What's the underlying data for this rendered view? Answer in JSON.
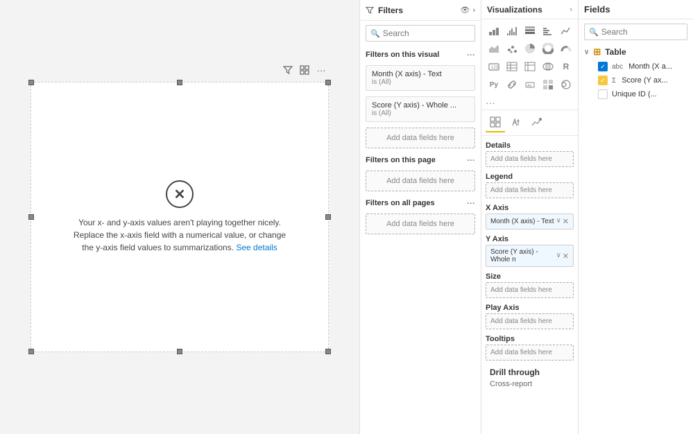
{
  "canvas": {
    "error_message": "Your x- and y-axis values aren't playing together nicely. Replace the x-axis field with a numerical value, or change the y-axis field values to summarizations.",
    "see_details": "See details",
    "toolbar": {
      "filter_icon": "▽",
      "focus_icon": "⊡",
      "more_icon": "···"
    }
  },
  "filters_panel": {
    "title": "Filters",
    "search_placeholder": "Search",
    "section_on_visual": "Filters on this visual",
    "section_on_page": "Filters on this page",
    "section_all_pages": "Filters on all pages",
    "filter1_title": "Month (X axis) - Text",
    "filter1_value": "is (All)",
    "filter2_title": "Score (Y axis) - Whole ...",
    "filter2_value": "is (All)",
    "add_data_label": "Add data fields here",
    "more_icon": "···"
  },
  "viz_panel": {
    "title": "Visualizations",
    "icons": [
      "📊",
      "📈",
      "📉",
      "📋",
      "🔲",
      "📍",
      "🗺",
      "⏱",
      "🥧",
      "📡",
      "🎯",
      "🔷",
      "🔵",
      "📐",
      "Ⓡ",
      "🐍",
      "🔗",
      "💬",
      "📺",
      "🖼"
    ],
    "tabs": [
      {
        "id": "fields",
        "icon": "⊞",
        "active": true
      },
      {
        "id": "format",
        "icon": "🎨",
        "active": false
      },
      {
        "id": "analytics",
        "icon": "🔍",
        "active": false
      }
    ],
    "details_label": "Details",
    "legend_label": "Legend",
    "x_axis_label": "X Axis",
    "y_axis_label": "Y Axis",
    "size_label": "Size",
    "play_axis_label": "Play Axis",
    "tooltips_label": "Tooltips",
    "drill_through_label": "Drill through",
    "cross_report_label": "Cross-report",
    "add_data_label": "Add data fields here",
    "x_axis_value": "Month (X axis) - Text",
    "y_axis_value": "Score (Y axis) - Whole n"
  },
  "fields_panel": {
    "title": "Fields",
    "search_placeholder": "Search",
    "table_name": "Table",
    "fields": [
      {
        "name": "Month (X a...",
        "checked": true,
        "type": "text"
      },
      {
        "name": "Score (Y ax...",
        "checked": true,
        "type": "sum"
      },
      {
        "name": "Unique ID (...",
        "checked": false,
        "type": "none"
      }
    ]
  }
}
